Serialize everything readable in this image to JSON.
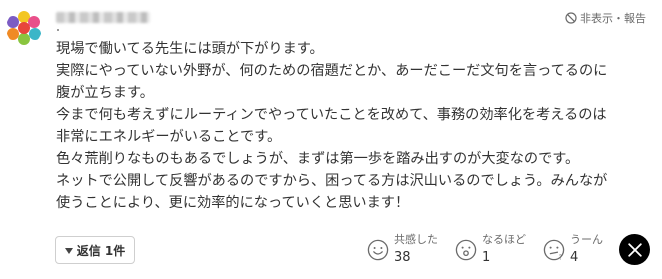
{
  "header": {
    "hide_report_label": "非表示・報告",
    "hide_report_icon": "hide-icon"
  },
  "comment": {
    "lines": [
      "現場で働いてる先生には頭が下がります。",
      "実際にやっていない外野が、何のための宿題だとか、あーだこーだ文句を言ってるのに",
      "腹が立ちます。",
      "今まで何も考えずにルーティンでやっていたことを改めて、事務の効率化を考えるのは",
      "非常にエネルギーがいることです。",
      "色々荒削りなものもあるでしょうが、まずは第一歩を踏み出すのが大変なのです。",
      "ネットで公開して反響があるのですから、困ってる方は沢山いるのでしょう。みんなが",
      "使うことにより、更に効率的になっていくと思います！"
    ]
  },
  "footer": {
    "reply_label": "返信 1件",
    "reactions": [
      {
        "label": "共感した",
        "count": "38",
        "icon": "smile-face-icon"
      },
      {
        "label": "なるほど",
        "count": "1",
        "icon": "surprised-face-icon"
      },
      {
        "label": "うーん",
        "count": "4",
        "icon": "thinking-face-icon"
      }
    ],
    "share_icon": "x-logo-icon"
  },
  "colors": {
    "text": "#333333",
    "muted": "#6b6b6b",
    "border": "#cfcfcf",
    "x_button": "#000000"
  }
}
